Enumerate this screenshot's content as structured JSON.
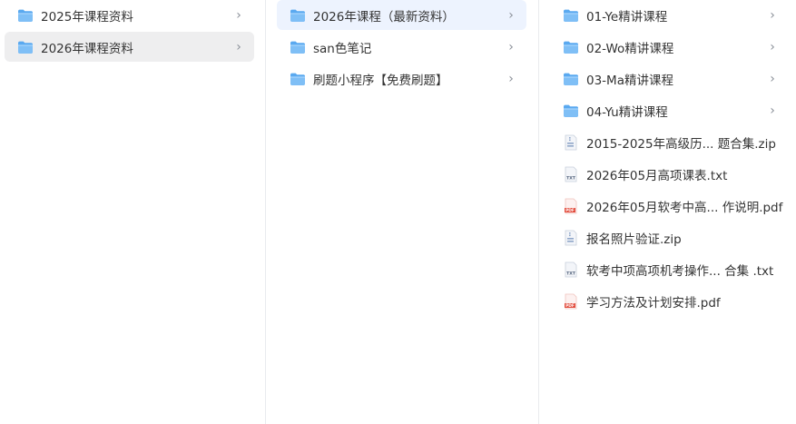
{
  "columns": [
    {
      "items": [
        {
          "label": "2025年课程资料",
          "type": "folder",
          "icon": "folder-icon"
        },
        {
          "label": "2026年课程资料",
          "type": "folder",
          "icon": "folder-icon",
          "selected": true
        }
      ]
    },
    {
      "items": [
        {
          "label": "2026年课程（最新资料）",
          "type": "folder",
          "icon": "folder-icon",
          "selected": true
        },
        {
          "label": "san色笔记",
          "type": "folder",
          "icon": "folder-icon"
        },
        {
          "label": "刷题小程序【免费刷题】",
          "type": "folder",
          "icon": "folder-icon"
        }
      ]
    },
    {
      "items": [
        {
          "label": "01-Ye精讲课程",
          "type": "folder",
          "icon": "folder-icon"
        },
        {
          "label": "02-Wo精讲课程",
          "type": "folder",
          "icon": "folder-icon"
        },
        {
          "label": "03-Ma精讲课程",
          "type": "folder",
          "icon": "folder-icon"
        },
        {
          "label": "04-Yu精讲课程",
          "type": "folder",
          "icon": "folder-icon"
        },
        {
          "label": "2015-2025年高级历...   题合集.zip",
          "type": "zip",
          "icon": "zip-file-icon"
        },
        {
          "label": "2026年05月高项课表.txt",
          "type": "txt",
          "icon": "txt-file-icon"
        },
        {
          "label": "2026年05月软考中高... 作说明.pdf",
          "type": "pdf",
          "icon": "pdf-file-icon"
        },
        {
          "label": "报名照片验证.zip",
          "type": "zip",
          "icon": "zip-file-icon"
        },
        {
          "label": "软考中项高项机考操作...   合集 .txt",
          "type": "txt",
          "icon": "txt-file-icon"
        },
        {
          "label": "学习方法及计划安排.pdf",
          "type": "pdf",
          "icon": "pdf-file-icon"
        }
      ]
    }
  ],
  "colors": {
    "folder": "#5aa9f0",
    "folder_light": "#9fd0fb",
    "selected_gray": "#eeeeef",
    "selected_blue": "#edf3fe",
    "pdf_red": "#e24a3b",
    "chevron": "#8a8f98"
  }
}
